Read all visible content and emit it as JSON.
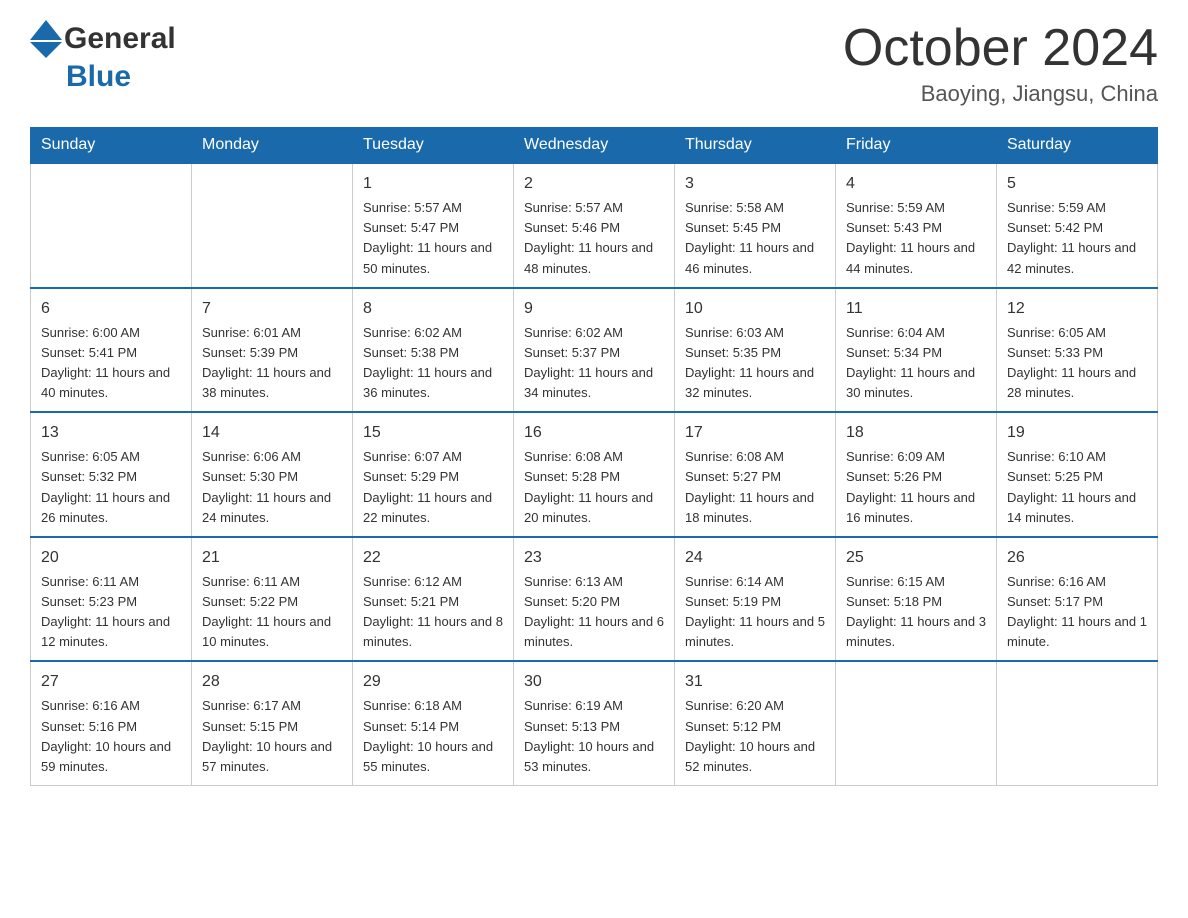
{
  "header": {
    "logo_general": "General",
    "logo_blue": "Blue",
    "month_title": "October 2024",
    "location": "Baoying, Jiangsu, China"
  },
  "weekdays": [
    "Sunday",
    "Monday",
    "Tuesday",
    "Wednesday",
    "Thursday",
    "Friday",
    "Saturday"
  ],
  "weeks": [
    [
      {
        "day": "",
        "sunrise": "",
        "sunset": "",
        "daylight": ""
      },
      {
        "day": "",
        "sunrise": "",
        "sunset": "",
        "daylight": ""
      },
      {
        "day": "1",
        "sunrise": "Sunrise: 5:57 AM",
        "sunset": "Sunset: 5:47 PM",
        "daylight": "Daylight: 11 hours and 50 minutes."
      },
      {
        "day": "2",
        "sunrise": "Sunrise: 5:57 AM",
        "sunset": "Sunset: 5:46 PM",
        "daylight": "Daylight: 11 hours and 48 minutes."
      },
      {
        "day": "3",
        "sunrise": "Sunrise: 5:58 AM",
        "sunset": "Sunset: 5:45 PM",
        "daylight": "Daylight: 11 hours and 46 minutes."
      },
      {
        "day": "4",
        "sunrise": "Sunrise: 5:59 AM",
        "sunset": "Sunset: 5:43 PM",
        "daylight": "Daylight: 11 hours and 44 minutes."
      },
      {
        "day": "5",
        "sunrise": "Sunrise: 5:59 AM",
        "sunset": "Sunset: 5:42 PM",
        "daylight": "Daylight: 11 hours and 42 minutes."
      }
    ],
    [
      {
        "day": "6",
        "sunrise": "Sunrise: 6:00 AM",
        "sunset": "Sunset: 5:41 PM",
        "daylight": "Daylight: 11 hours and 40 minutes."
      },
      {
        "day": "7",
        "sunrise": "Sunrise: 6:01 AM",
        "sunset": "Sunset: 5:39 PM",
        "daylight": "Daylight: 11 hours and 38 minutes."
      },
      {
        "day": "8",
        "sunrise": "Sunrise: 6:02 AM",
        "sunset": "Sunset: 5:38 PM",
        "daylight": "Daylight: 11 hours and 36 minutes."
      },
      {
        "day": "9",
        "sunrise": "Sunrise: 6:02 AM",
        "sunset": "Sunset: 5:37 PM",
        "daylight": "Daylight: 11 hours and 34 minutes."
      },
      {
        "day": "10",
        "sunrise": "Sunrise: 6:03 AM",
        "sunset": "Sunset: 5:35 PM",
        "daylight": "Daylight: 11 hours and 32 minutes."
      },
      {
        "day": "11",
        "sunrise": "Sunrise: 6:04 AM",
        "sunset": "Sunset: 5:34 PM",
        "daylight": "Daylight: 11 hours and 30 minutes."
      },
      {
        "day": "12",
        "sunrise": "Sunrise: 6:05 AM",
        "sunset": "Sunset: 5:33 PM",
        "daylight": "Daylight: 11 hours and 28 minutes."
      }
    ],
    [
      {
        "day": "13",
        "sunrise": "Sunrise: 6:05 AM",
        "sunset": "Sunset: 5:32 PM",
        "daylight": "Daylight: 11 hours and 26 minutes."
      },
      {
        "day": "14",
        "sunrise": "Sunrise: 6:06 AM",
        "sunset": "Sunset: 5:30 PM",
        "daylight": "Daylight: 11 hours and 24 minutes."
      },
      {
        "day": "15",
        "sunrise": "Sunrise: 6:07 AM",
        "sunset": "Sunset: 5:29 PM",
        "daylight": "Daylight: 11 hours and 22 minutes."
      },
      {
        "day": "16",
        "sunrise": "Sunrise: 6:08 AM",
        "sunset": "Sunset: 5:28 PM",
        "daylight": "Daylight: 11 hours and 20 minutes."
      },
      {
        "day": "17",
        "sunrise": "Sunrise: 6:08 AM",
        "sunset": "Sunset: 5:27 PM",
        "daylight": "Daylight: 11 hours and 18 minutes."
      },
      {
        "day": "18",
        "sunrise": "Sunrise: 6:09 AM",
        "sunset": "Sunset: 5:26 PM",
        "daylight": "Daylight: 11 hours and 16 minutes."
      },
      {
        "day": "19",
        "sunrise": "Sunrise: 6:10 AM",
        "sunset": "Sunset: 5:25 PM",
        "daylight": "Daylight: 11 hours and 14 minutes."
      }
    ],
    [
      {
        "day": "20",
        "sunrise": "Sunrise: 6:11 AM",
        "sunset": "Sunset: 5:23 PM",
        "daylight": "Daylight: 11 hours and 12 minutes."
      },
      {
        "day": "21",
        "sunrise": "Sunrise: 6:11 AM",
        "sunset": "Sunset: 5:22 PM",
        "daylight": "Daylight: 11 hours and 10 minutes."
      },
      {
        "day": "22",
        "sunrise": "Sunrise: 6:12 AM",
        "sunset": "Sunset: 5:21 PM",
        "daylight": "Daylight: 11 hours and 8 minutes."
      },
      {
        "day": "23",
        "sunrise": "Sunrise: 6:13 AM",
        "sunset": "Sunset: 5:20 PM",
        "daylight": "Daylight: 11 hours and 6 minutes."
      },
      {
        "day": "24",
        "sunrise": "Sunrise: 6:14 AM",
        "sunset": "Sunset: 5:19 PM",
        "daylight": "Daylight: 11 hours and 5 minutes."
      },
      {
        "day": "25",
        "sunrise": "Sunrise: 6:15 AM",
        "sunset": "Sunset: 5:18 PM",
        "daylight": "Daylight: 11 hours and 3 minutes."
      },
      {
        "day": "26",
        "sunrise": "Sunrise: 6:16 AM",
        "sunset": "Sunset: 5:17 PM",
        "daylight": "Daylight: 11 hours and 1 minute."
      }
    ],
    [
      {
        "day": "27",
        "sunrise": "Sunrise: 6:16 AM",
        "sunset": "Sunset: 5:16 PM",
        "daylight": "Daylight: 10 hours and 59 minutes."
      },
      {
        "day": "28",
        "sunrise": "Sunrise: 6:17 AM",
        "sunset": "Sunset: 5:15 PM",
        "daylight": "Daylight: 10 hours and 57 minutes."
      },
      {
        "day": "29",
        "sunrise": "Sunrise: 6:18 AM",
        "sunset": "Sunset: 5:14 PM",
        "daylight": "Daylight: 10 hours and 55 minutes."
      },
      {
        "day": "30",
        "sunrise": "Sunrise: 6:19 AM",
        "sunset": "Sunset: 5:13 PM",
        "daylight": "Daylight: 10 hours and 53 minutes."
      },
      {
        "day": "31",
        "sunrise": "Sunrise: 6:20 AM",
        "sunset": "Sunset: 5:12 PM",
        "daylight": "Daylight: 10 hours and 52 minutes."
      },
      {
        "day": "",
        "sunrise": "",
        "sunset": "",
        "daylight": ""
      },
      {
        "day": "",
        "sunrise": "",
        "sunset": "",
        "daylight": ""
      }
    ]
  ]
}
